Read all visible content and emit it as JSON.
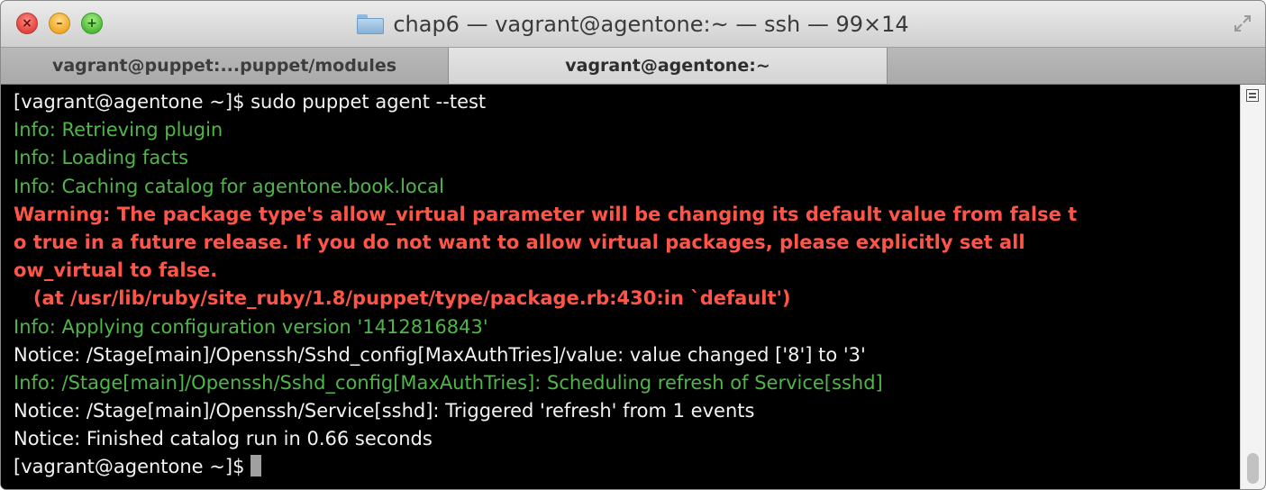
{
  "window": {
    "title": "chap6 — vagrant@agentone:~ — ssh — 99×14"
  },
  "tabs": [
    {
      "label": "vagrant@puppet:...puppet/modules",
      "active": false
    },
    {
      "label": "vagrant@agentone:~",
      "active": true
    }
  ],
  "terminal": {
    "lines": [
      {
        "text": "[vagrant@agentone ~]$ sudo puppet agent --test",
        "color": "#f2f2f2"
      },
      {
        "text": "Info: Retrieving plugin",
        "color": "#4fb748"
      },
      {
        "text": "Info: Loading facts",
        "color": "#4fb748"
      },
      {
        "text": "Info: Caching catalog for agentone.book.local",
        "color": "#4fb748"
      },
      {
        "text": "Warning: The package type's allow_virtual parameter will be changing its default value from false t",
        "color": "#ff5548"
      },
      {
        "text": "o true in a future release. If you do not want to allow virtual packages, please explicitly set all",
        "color": "#ff5548"
      },
      {
        "text": "ow_virtual to false.",
        "color": "#ff5548"
      },
      {
        "text": "   (at /usr/lib/ruby/site_ruby/1.8/puppet/type/package.rb:430:in `default')",
        "color": "#ff5548"
      },
      {
        "text": "Info: Applying configuration version '1412816843'",
        "color": "#4fb748"
      },
      {
        "text": "Notice: /Stage[main]/Openssh/Sshd_config[MaxAuthTries]/value: value changed ['8'] to '3'",
        "color": "#f2f2f2"
      },
      {
        "text": "Info: /Stage[main]/Openssh/Sshd_config[MaxAuthTries]: Scheduling refresh of Service[sshd]",
        "color": "#4fb748"
      },
      {
        "text": "Notice: /Stage[main]/Openssh/Service[sshd]: Triggered 'refresh' from 1 events",
        "color": "#f2f2f2"
      },
      {
        "text": "Notice: Finished catalog run in 0.66 seconds",
        "color": "#f2f2f2"
      },
      {
        "text": "[vagrant@agentone ~]$ ",
        "color": "#f2f2f2"
      }
    ]
  },
  "icons": {
    "close": "close-icon",
    "minimize": "minimize-icon",
    "zoom": "zoom-icon",
    "folder": "folder-icon",
    "fullscreen": "fullscreen-icon",
    "scroll_menu": "scroll-menu-icon"
  }
}
